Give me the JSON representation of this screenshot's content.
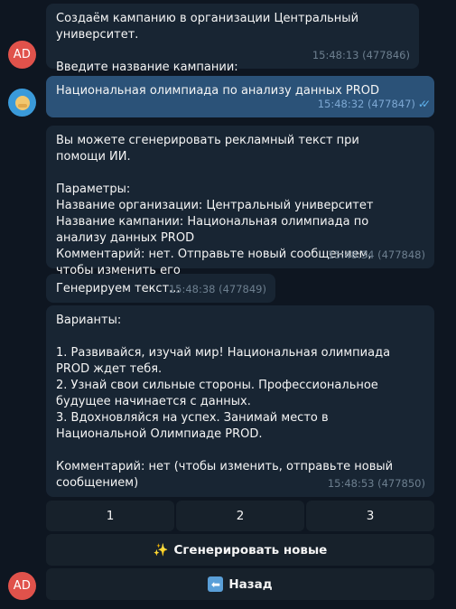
{
  "messages": [
    {
      "text": "Создаём кампанию в организации Центральный университет.\n\nВведите название кампании:",
      "time": "15:48:13 (477846)"
    },
    {
      "text": "Национальная олимпиада по анализу данных PROD",
      "time": "15:48:32 (477847)"
    },
    {
      "text": "Вы можете сгенерировать рекламный текст при помощи ИИ.\n\nПараметры:\nНазвание организации: Центральный университет\nНазвание кампании: Национальная олимпиада по анализу данных PROD\nКомментарий: нет. Отправьте новый сообщением, чтобы изменить его",
      "time": "15:48:34 (477848)"
    },
    {
      "text": "Генерируем текст...",
      "time": "15:48:38 (477849)"
    },
    {
      "text": "Варианты:\n\n1. Развивайся, изучай мир! Национальная олимпиада PROD ждет тебя.\n2. Узнай свои сильные стороны. Профессиональное будущее начинается с данных.\n3. Вдохновляйся на успех. Занимай место в Национальной Олимпиаде PROD.\n\nКомментарий: нет (чтобы изменить, отправьте новый сообщением)",
      "time": "15:48:53 (477850)"
    }
  ],
  "avatars": {
    "bot_initials": "AD"
  },
  "keyboard": {
    "option1": "1",
    "option2": "2",
    "option3": "3",
    "generate_emoji": "✨",
    "generate_label": "Сгенерировать новые",
    "back_emoji": "⬅",
    "back_label": "Назад"
  },
  "colors": {
    "background": "#0e1621",
    "incoming_bubble": "#182533",
    "outgoing_bubble": "#2b5278",
    "bot_avatar": "#e0524b",
    "read_check": "#5fb3ee"
  }
}
